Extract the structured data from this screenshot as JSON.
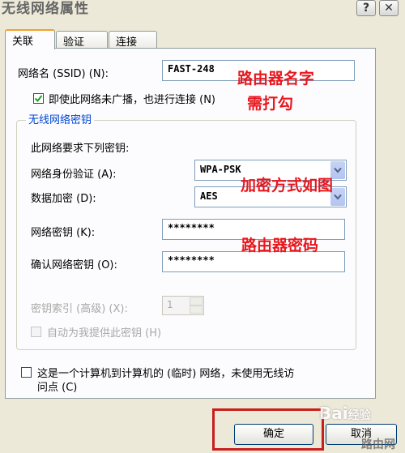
{
  "window": {
    "title": "无线网络属性",
    "help_glyph": "?",
    "close_glyph": "✕"
  },
  "tabs": [
    {
      "label": "关联"
    },
    {
      "label": "验证"
    },
    {
      "label": "连接"
    }
  ],
  "ssid": {
    "label": "网络名 (SSID) (N):",
    "value": "FAST-248"
  },
  "broadcast": {
    "label": "即使此网络未广播，也进行连接 (N)",
    "checked": true
  },
  "key_group": {
    "title": "无线网络密钥",
    "subtitle": "此网络要求下列密钥:",
    "auth": {
      "label": "网络身份验证 (A):",
      "value": "WPA-PSK"
    },
    "encryption": {
      "label": "数据加密 (D):",
      "value": "AES"
    },
    "key": {
      "label": "网络密钥 (K):",
      "value": "********"
    },
    "confirm": {
      "label": "确认网络密钥 (O):",
      "value": "********"
    },
    "key_index": {
      "label": "密钥索引 (高级) (X):",
      "value": "1"
    },
    "auto_key": {
      "label": "自动为我提供此密钥 (H)"
    }
  },
  "adhoc": {
    "label_line1": "这是一个计算机到计算机的 (临时) 网络，未使用无线访",
    "label_line2": "问点 (C)"
  },
  "buttons": {
    "ok": "确定",
    "cancel": "取消"
  },
  "annotations": {
    "router_name": "路由器名字",
    "check_needed": "需打勾",
    "encryption_method": "加密方式如图",
    "router_password": "路由器密码"
  },
  "watermark": {
    "brand": "Bai",
    "suffix": "经验",
    "corner": "路由网"
  },
  "colors": {
    "annotation_red": "#e8171d",
    "group_title_blue": "#0046d5",
    "tab_highlight": "#f0a030"
  }
}
